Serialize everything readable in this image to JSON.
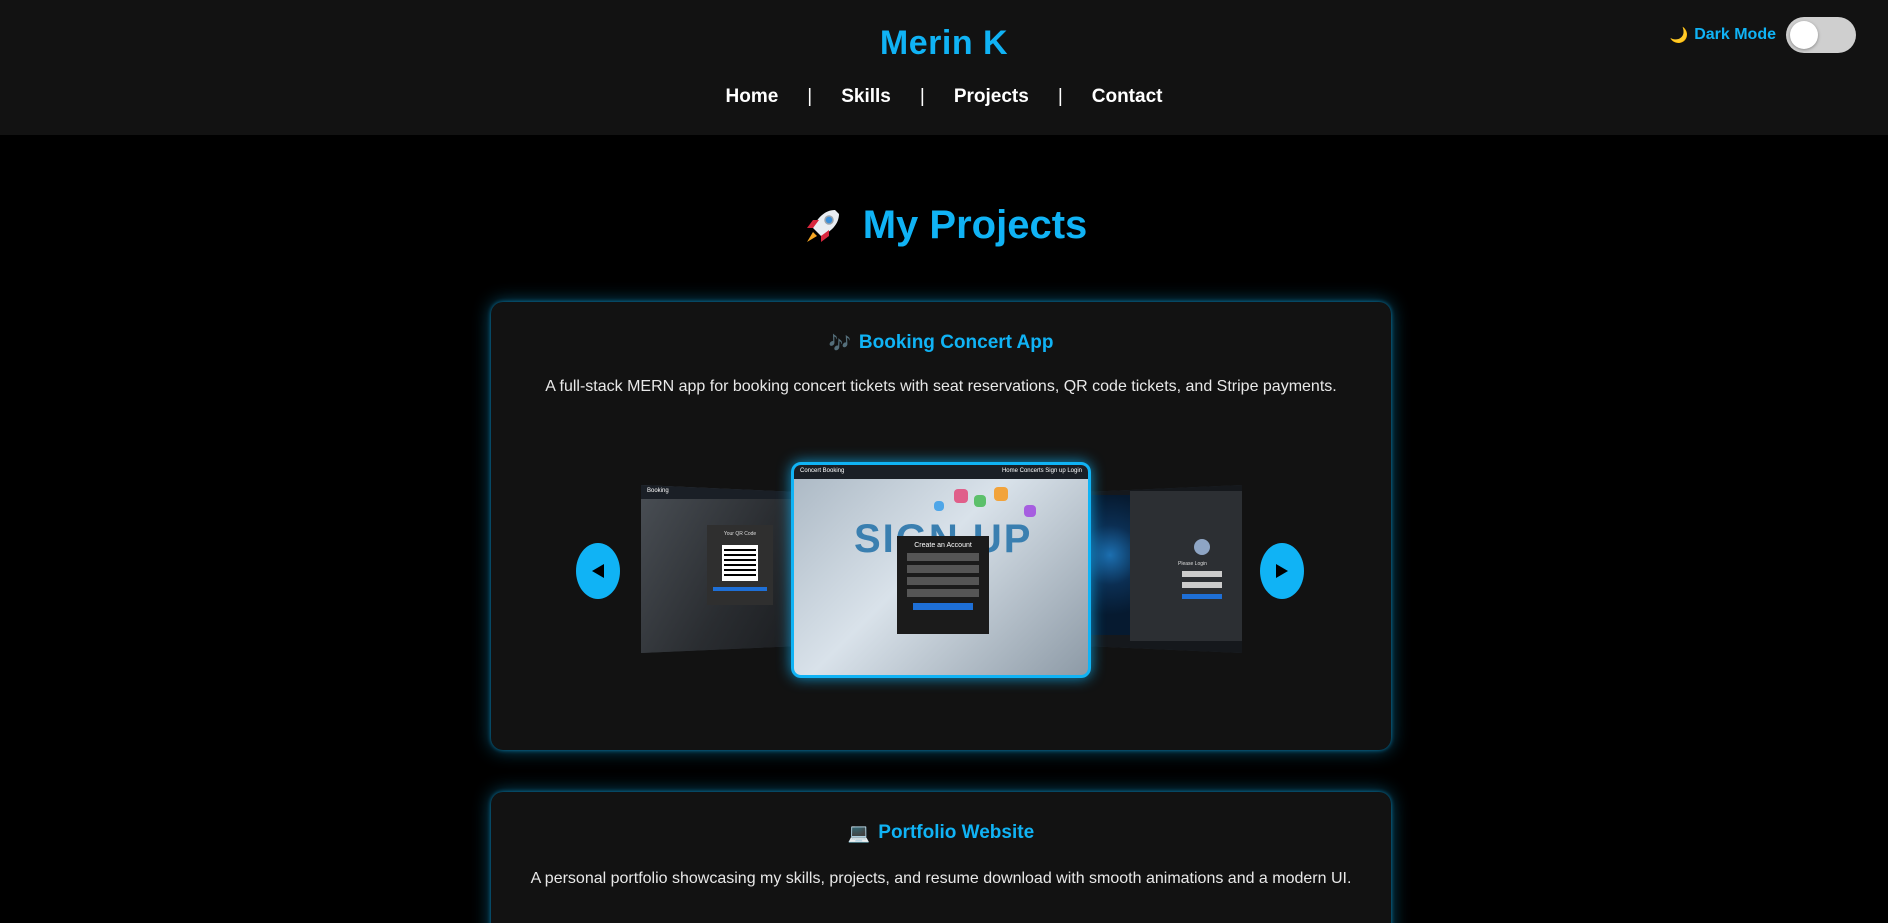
{
  "header": {
    "brand": "Merin K",
    "nav": [
      {
        "label": "Home"
      },
      {
        "label": "Skills"
      },
      {
        "label": "Projects"
      },
      {
        "label": "Contact"
      }
    ],
    "separator": "|",
    "theme_toggle": {
      "icon": "moon-icon",
      "label": "Dark Mode",
      "checked": false
    }
  },
  "section": {
    "icon": "rocket-icon",
    "title": "My Projects"
  },
  "projects": [
    {
      "emoji": "🎶",
      "title": "Booking Concert App",
      "description": "A full-stack MERN app for booking concert tickets with seat reservations, QR code tickets, and Stripe payments.",
      "carousel": {
        "prev_icon": "arrow-left-icon",
        "next_icon": "arrow-right-icon",
        "slides": [
          {
            "caption_nav": "Booking",
            "qr_title": "Your QR Code"
          },
          {
            "caption_nav": "Concert Booking",
            "nav_right": "Home  Concerts  Sign up  Login",
            "background_text": "SIGN UP",
            "modal_title": "Create an Account"
          },
          {
            "login_title": "Please Login"
          }
        ]
      }
    },
    {
      "emoji": "💻",
      "title": "Portfolio Website",
      "description": "A personal portfolio showcasing my skills, projects, and resume download with smooth animations and a modern UI."
    }
  ],
  "colors": {
    "accent": "#10b3f5",
    "header_bg": "#121212",
    "page_bg": "#000000",
    "card_bg": "#121212"
  }
}
